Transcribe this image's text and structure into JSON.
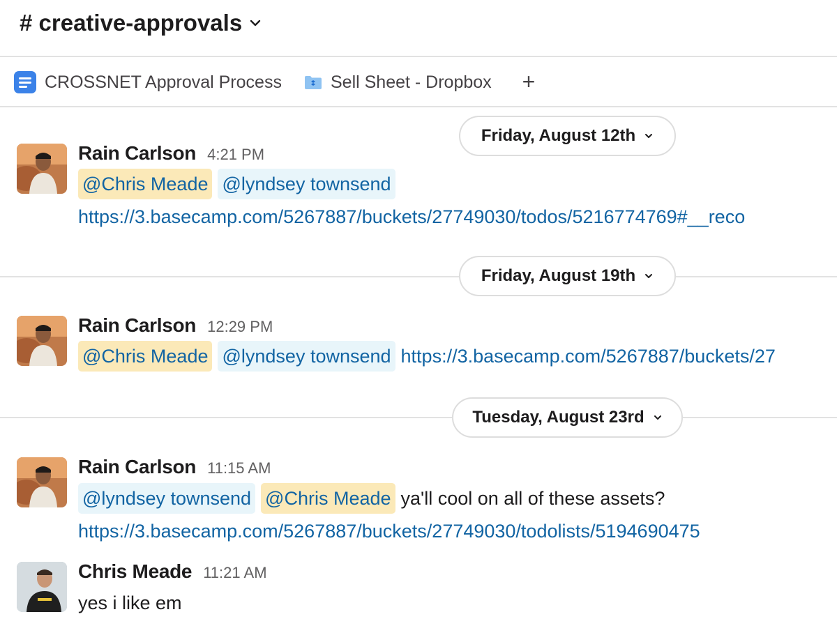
{
  "header": {
    "channel_name": "# creative-approvals"
  },
  "bookmarks": {
    "items": [
      {
        "label": "CROSSNET Approval Process",
        "icon": "document-icon"
      },
      {
        "label": "Sell Sheet - Dropbox",
        "icon": "dropbox-folder-icon"
      }
    ],
    "add_label": "+"
  },
  "days": [
    {
      "label": "Friday, August 12th"
    },
    {
      "label": "Friday, August 19th"
    },
    {
      "label": "Tuesday, August 23rd"
    }
  ],
  "messages": [
    {
      "sender": "Rain Carlson",
      "time": "4:21 PM",
      "mention_1": "@Chris Meade",
      "mention_2": "@lyndsey townsend",
      "link": "https://3.basecamp.com/5267887/buckets/27749030/todos/5216774769#__reco"
    },
    {
      "sender": "Rain Carlson",
      "time": "12:29 PM",
      "mention_1": "@Chris Meade",
      "mention_2": "@lyndsey townsend",
      "link": "https://3.basecamp.com/5267887/buckets/27"
    },
    {
      "sender": "Rain Carlson",
      "time": "11:15 AM",
      "mention_1": "@lyndsey townsend",
      "mention_2": "@Chris Meade",
      "text": "ya'll cool on all of these assets?",
      "link": "https://3.basecamp.com/5267887/buckets/27749030/todolists/5194690475"
    },
    {
      "sender": "Chris Meade",
      "time": "11:21 AM",
      "text": "yes i like em"
    }
  ],
  "colors": {
    "link": "#1264a3",
    "mention_highlight_bg": "#fbe9b8",
    "mention_bg": "#e8f5fa"
  }
}
